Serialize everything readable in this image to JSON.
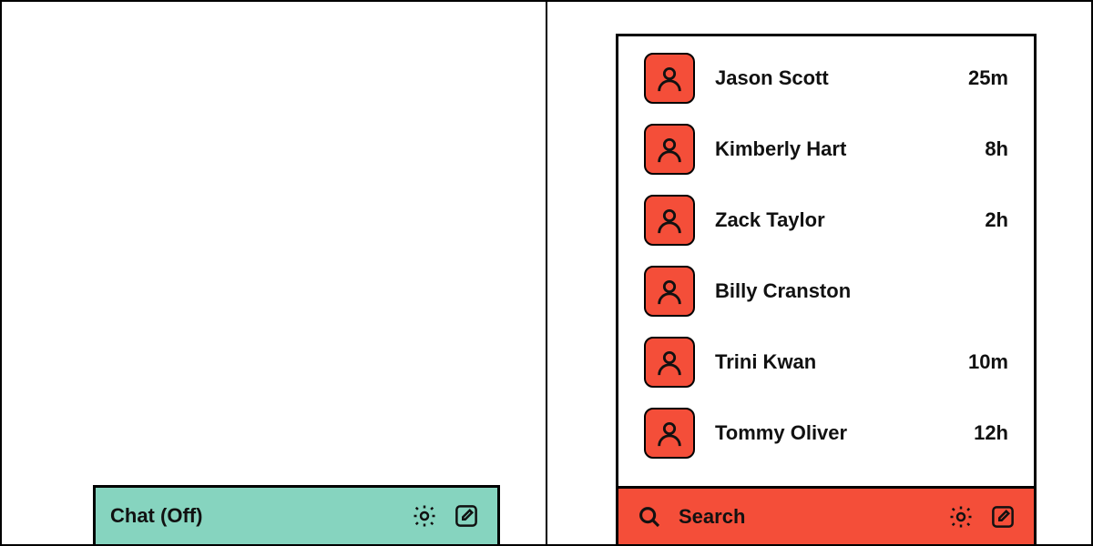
{
  "left": {
    "chat_title": "Chat (Off)"
  },
  "right": {
    "search_label": "Search",
    "contacts": [
      {
        "name": "Jason Scott",
        "time": "25m",
        "online": false
      },
      {
        "name": "Kimberly Hart",
        "time": "8h",
        "online": false
      },
      {
        "name": "Zack Taylor",
        "time": "2h",
        "online": false
      },
      {
        "name": "Billy Cranston",
        "time": "",
        "online": true
      },
      {
        "name": "Trini Kwan",
        "time": "10m",
        "online": false
      },
      {
        "name": "Tommy Oliver",
        "time": "12h",
        "online": false
      }
    ]
  },
  "colors": {
    "accent_left": "#86d4bf",
    "accent_right": "#f44e39"
  }
}
